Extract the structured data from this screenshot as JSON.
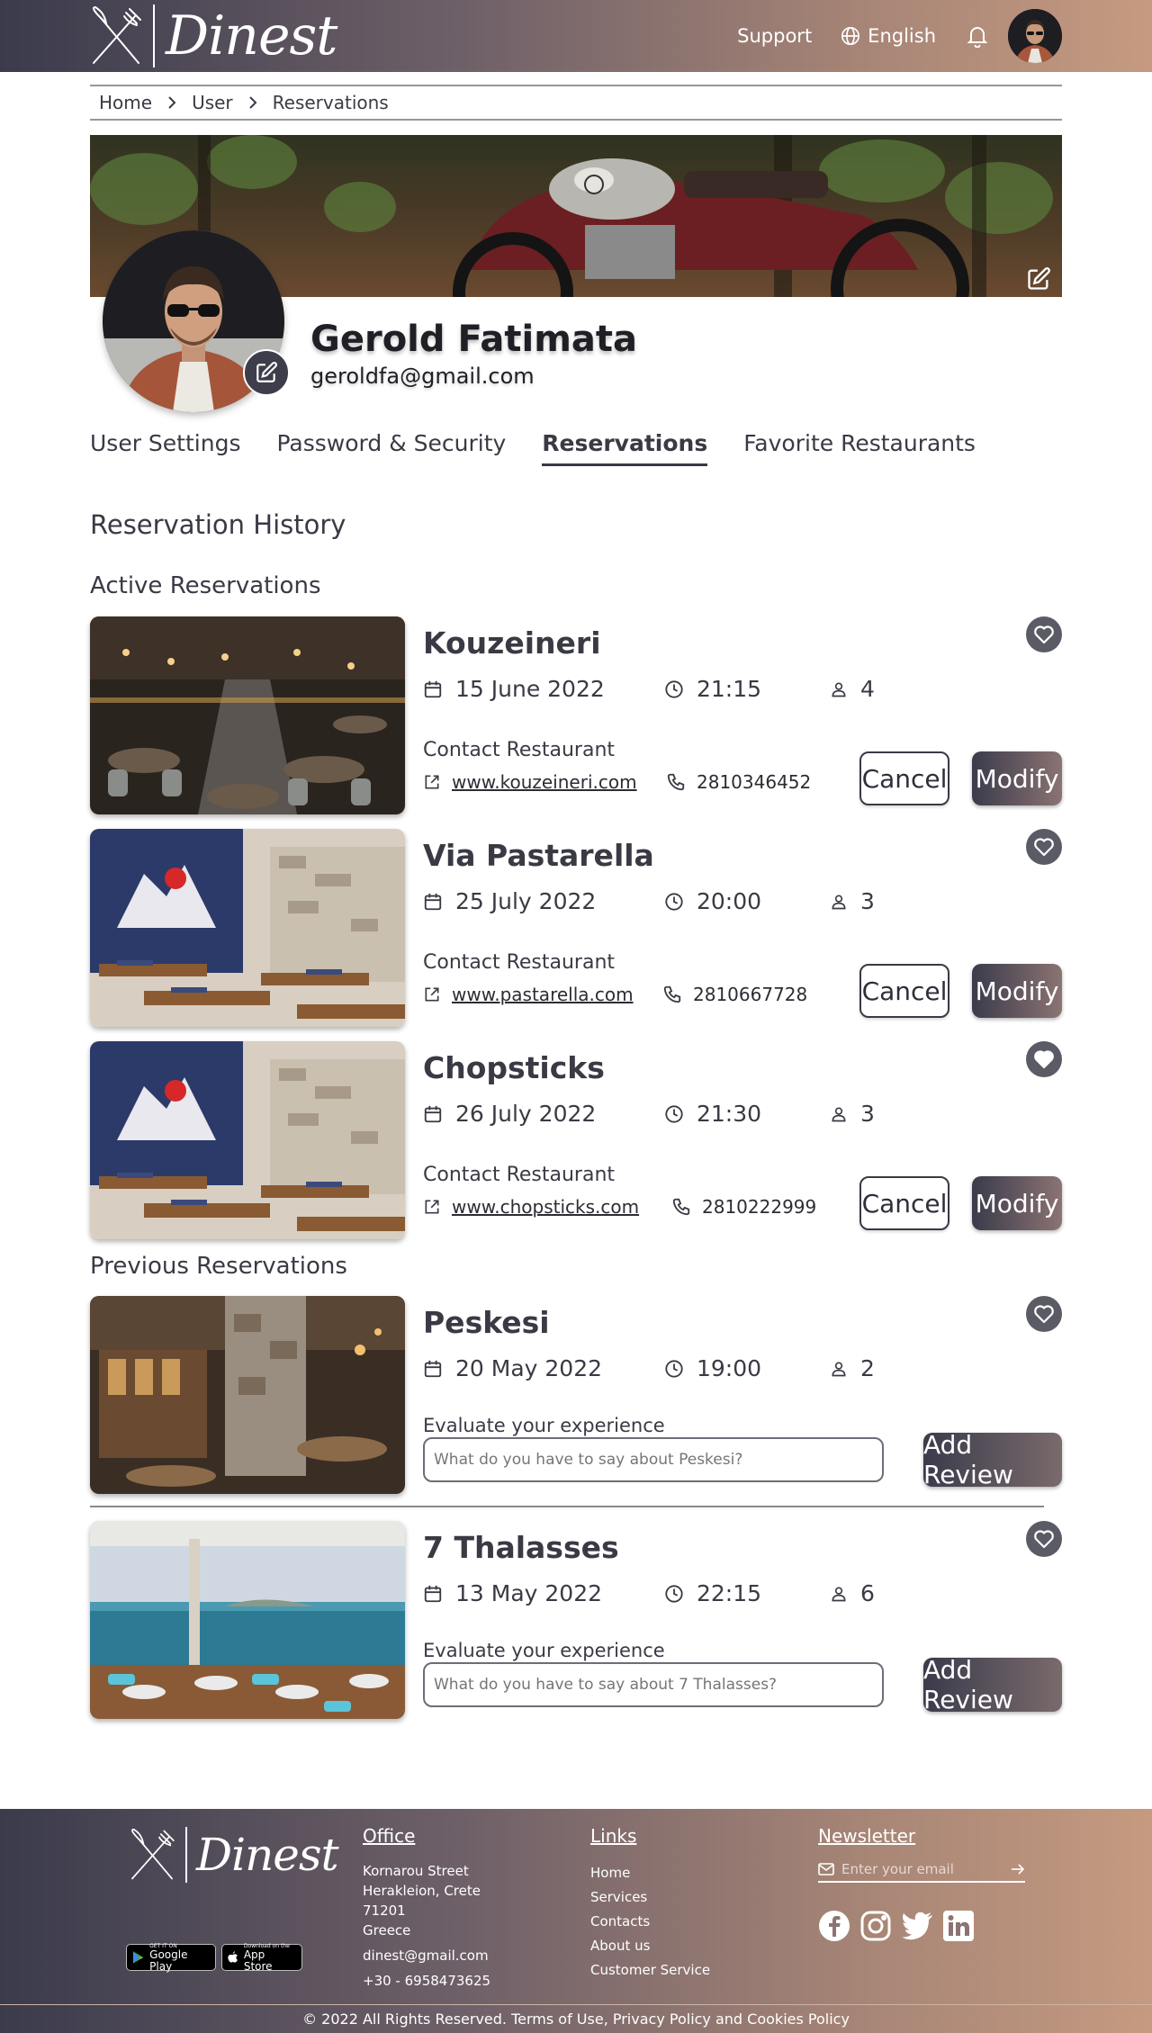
{
  "brand": {
    "name": "Dinest"
  },
  "nav": {
    "support": "Support",
    "language": "English"
  },
  "breadcrumb": [
    "Home",
    "User",
    "Reservations"
  ],
  "profile": {
    "name": "Gerold Fatimata",
    "email": "geroldfa@gmail.com"
  },
  "tabs": [
    {
      "label": "User Settings",
      "active": false
    },
    {
      "label": "Password & Security",
      "active": false
    },
    {
      "label": "Reservations",
      "active": true
    },
    {
      "label": "Favorite Restaurants",
      "active": false
    }
  ],
  "history": {
    "title": "Reservation History",
    "active_title": "Active Reservations",
    "previous_title": "Previous Reservations"
  },
  "active_reservations": [
    {
      "name": "Kouzeineri",
      "date": "15 June 2022",
      "time": "21:15",
      "people": "4",
      "contact_label": "Contact Restaurant",
      "website": "www.kouzeineri.com",
      "phone": "2810346452",
      "cancel": "Cancel",
      "modify": "Modify",
      "favorite": false
    },
    {
      "name": "Via Pastarella",
      "date": "25 July 2022",
      "time": "20:00",
      "people": "3",
      "contact_label": "Contact Restaurant",
      "website": "www.pastarella.com",
      "phone": "2810667728",
      "cancel": "Cancel",
      "modify": "Modify",
      "favorite": false
    },
    {
      "name": "Chopsticks",
      "date": "26 July 2022",
      "time": "21:30",
      "people": "3",
      "contact_label": "Contact Restaurant",
      "website": "www.chopsticks.com",
      "phone": "2810222999",
      "cancel": "Cancel",
      "modify": "Modify",
      "favorite": true
    }
  ],
  "previous_reservations": [
    {
      "name": "Peskesi",
      "date": "20 May 2022",
      "time": "19:00",
      "people": "2",
      "evaluate_label": "Evaluate your experience",
      "placeholder": "What do you have to say about Peskesi?",
      "button": "Add Review",
      "favorite": false
    },
    {
      "name": "7 Thalasses",
      "date": "13 May 2022",
      "time": "22:15",
      "people": "6",
      "evaluate_label": "Evaluate your experience",
      "placeholder": "What do you have to say about 7 Thalasses?",
      "button": "Add Review",
      "favorite": false
    }
  ],
  "footer": {
    "office": {
      "title": "Office",
      "lines": [
        "Kornarou Street",
        "Herakleion, Crete",
        "71201",
        "Greece"
      ],
      "email": "dinest@gmail.com",
      "phone": "+30 - 6958473625"
    },
    "links": {
      "title": "Links",
      "items": [
        "Home",
        "Services",
        "Contacts",
        "About us",
        "Customer Service"
      ]
    },
    "newsletter": {
      "title": "Newsletter",
      "placeholder": "Enter your email"
    },
    "stores": {
      "google_small": "GET IT ON",
      "google_big": "Google Play",
      "apple_small": "Download on the",
      "apple_big": "App Store"
    },
    "copyright": "© 2022 All Rights Reserved. Terms of Use, Privacy Policy and Cookies Policy"
  },
  "colors": {
    "accent_dark": "#3b3b4c",
    "accent_warm": "#c59a80",
    "heart": "#5b5b66"
  },
  "icons": [
    "fork-knife-icon",
    "globe-icon",
    "bell-icon",
    "edit-icon",
    "heart-icon",
    "calendar-icon",
    "clock-icon",
    "person-icon",
    "external-link-icon",
    "phone-icon",
    "mail-icon",
    "arrow-right-icon",
    "facebook-icon",
    "instagram-icon",
    "twitter-icon",
    "linkedin-icon"
  ]
}
